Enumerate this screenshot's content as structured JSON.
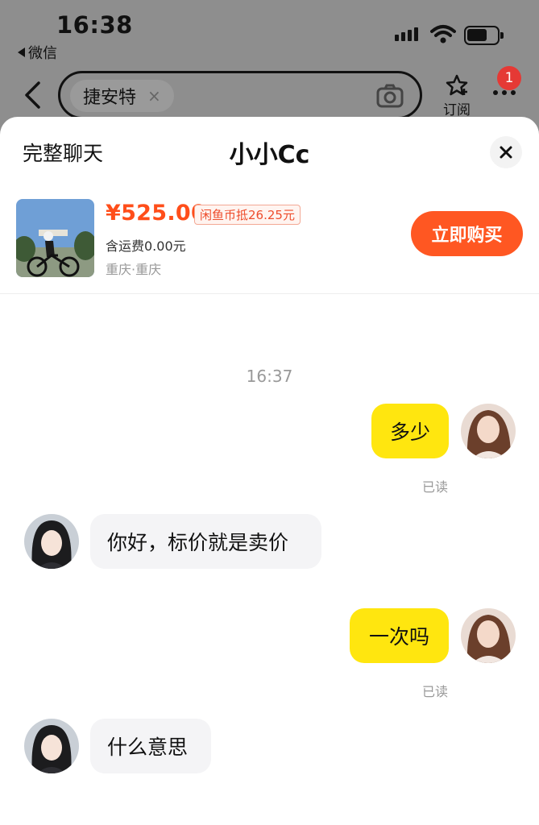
{
  "status_bar": {
    "time": "16:38",
    "back_app_label": "微信"
  },
  "top_nav": {
    "search_chip": "捷安特",
    "chip_clear": "×",
    "subscribe_label": "订阅",
    "notification_count": "1"
  },
  "sheet": {
    "full_chat_label": "完整聊天",
    "title": "小小Cc",
    "close": "×"
  },
  "product": {
    "price": "¥525.00",
    "coin_tag": "闲鱼币抵26.25元",
    "shipping": "含运费0.00元",
    "location": "重庆·重庆",
    "buy_button": "立即购买"
  },
  "chat": {
    "timestamp": "16:37",
    "messages": [
      {
        "sender": "me",
        "text": "多少",
        "status": "已读"
      },
      {
        "sender": "them",
        "text": "你好，标价就是卖价"
      },
      {
        "sender": "me",
        "text": "一次吗",
        "status": "已读"
      },
      {
        "sender": "them",
        "text": "什么意思"
      }
    ]
  },
  "colors": {
    "accent_orange": "#ff5722",
    "price_red": "#ff4e1a",
    "my_bubble": "#ffe60f",
    "their_bubble": "#f4f4f6"
  }
}
